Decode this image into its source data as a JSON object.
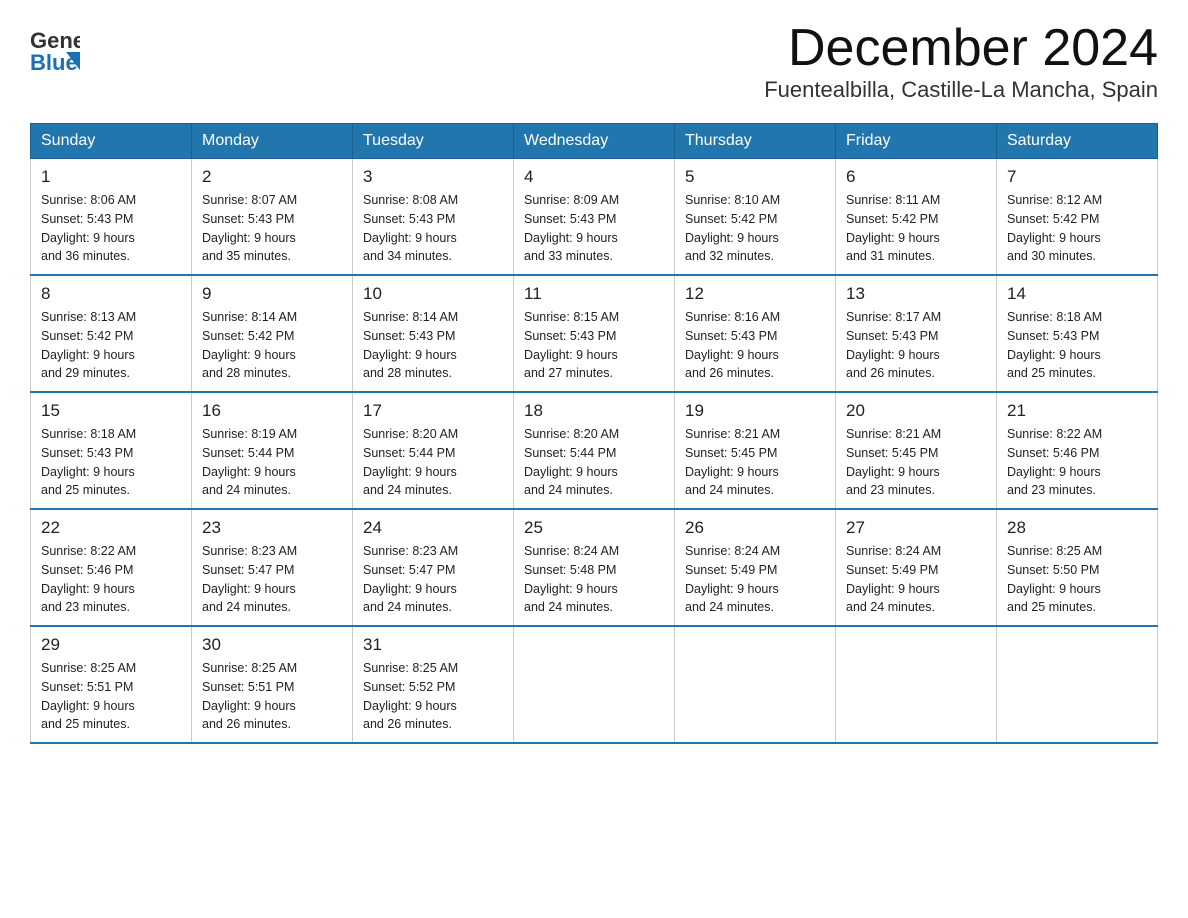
{
  "header": {
    "logo_general": "General",
    "logo_blue": "Blue",
    "title": "December 2024",
    "subtitle": "Fuentealbilla, Castille-La Mancha, Spain"
  },
  "calendar": {
    "days_of_week": [
      "Sunday",
      "Monday",
      "Tuesday",
      "Wednesday",
      "Thursday",
      "Friday",
      "Saturday"
    ],
    "weeks": [
      [
        {
          "day": "1",
          "sunrise": "8:06 AM",
          "sunset": "5:43 PM",
          "daylight": "9 hours and 36 minutes."
        },
        {
          "day": "2",
          "sunrise": "8:07 AM",
          "sunset": "5:43 PM",
          "daylight": "9 hours and 35 minutes."
        },
        {
          "day": "3",
          "sunrise": "8:08 AM",
          "sunset": "5:43 PM",
          "daylight": "9 hours and 34 minutes."
        },
        {
          "day": "4",
          "sunrise": "8:09 AM",
          "sunset": "5:43 PM",
          "daylight": "9 hours and 33 minutes."
        },
        {
          "day": "5",
          "sunrise": "8:10 AM",
          "sunset": "5:42 PM",
          "daylight": "9 hours and 32 minutes."
        },
        {
          "day": "6",
          "sunrise": "8:11 AM",
          "sunset": "5:42 PM",
          "daylight": "9 hours and 31 minutes."
        },
        {
          "day": "7",
          "sunrise": "8:12 AM",
          "sunset": "5:42 PM",
          "daylight": "9 hours and 30 minutes."
        }
      ],
      [
        {
          "day": "8",
          "sunrise": "8:13 AM",
          "sunset": "5:42 PM",
          "daylight": "9 hours and 29 minutes."
        },
        {
          "day": "9",
          "sunrise": "8:14 AM",
          "sunset": "5:42 PM",
          "daylight": "9 hours and 28 minutes."
        },
        {
          "day": "10",
          "sunrise": "8:14 AM",
          "sunset": "5:43 PM",
          "daylight": "9 hours and 28 minutes."
        },
        {
          "day": "11",
          "sunrise": "8:15 AM",
          "sunset": "5:43 PM",
          "daylight": "9 hours and 27 minutes."
        },
        {
          "day": "12",
          "sunrise": "8:16 AM",
          "sunset": "5:43 PM",
          "daylight": "9 hours and 26 minutes."
        },
        {
          "day": "13",
          "sunrise": "8:17 AM",
          "sunset": "5:43 PM",
          "daylight": "9 hours and 26 minutes."
        },
        {
          "day": "14",
          "sunrise": "8:18 AM",
          "sunset": "5:43 PM",
          "daylight": "9 hours and 25 minutes."
        }
      ],
      [
        {
          "day": "15",
          "sunrise": "8:18 AM",
          "sunset": "5:43 PM",
          "daylight": "9 hours and 25 minutes."
        },
        {
          "day": "16",
          "sunrise": "8:19 AM",
          "sunset": "5:44 PM",
          "daylight": "9 hours and 24 minutes."
        },
        {
          "day": "17",
          "sunrise": "8:20 AM",
          "sunset": "5:44 PM",
          "daylight": "9 hours and 24 minutes."
        },
        {
          "day": "18",
          "sunrise": "8:20 AM",
          "sunset": "5:44 PM",
          "daylight": "9 hours and 24 minutes."
        },
        {
          "day": "19",
          "sunrise": "8:21 AM",
          "sunset": "5:45 PM",
          "daylight": "9 hours and 24 minutes."
        },
        {
          "day": "20",
          "sunrise": "8:21 AM",
          "sunset": "5:45 PM",
          "daylight": "9 hours and 23 minutes."
        },
        {
          "day": "21",
          "sunrise": "8:22 AM",
          "sunset": "5:46 PM",
          "daylight": "9 hours and 23 minutes."
        }
      ],
      [
        {
          "day": "22",
          "sunrise": "8:22 AM",
          "sunset": "5:46 PM",
          "daylight": "9 hours and 23 minutes."
        },
        {
          "day": "23",
          "sunrise": "8:23 AM",
          "sunset": "5:47 PM",
          "daylight": "9 hours and 24 minutes."
        },
        {
          "day": "24",
          "sunrise": "8:23 AM",
          "sunset": "5:47 PM",
          "daylight": "9 hours and 24 minutes."
        },
        {
          "day": "25",
          "sunrise": "8:24 AM",
          "sunset": "5:48 PM",
          "daylight": "9 hours and 24 minutes."
        },
        {
          "day": "26",
          "sunrise": "8:24 AM",
          "sunset": "5:49 PM",
          "daylight": "9 hours and 24 minutes."
        },
        {
          "day": "27",
          "sunrise": "8:24 AM",
          "sunset": "5:49 PM",
          "daylight": "9 hours and 24 minutes."
        },
        {
          "day": "28",
          "sunrise": "8:25 AM",
          "sunset": "5:50 PM",
          "daylight": "9 hours and 25 minutes."
        }
      ],
      [
        {
          "day": "29",
          "sunrise": "8:25 AM",
          "sunset": "5:51 PM",
          "daylight": "9 hours and 25 minutes."
        },
        {
          "day": "30",
          "sunrise": "8:25 AM",
          "sunset": "5:51 PM",
          "daylight": "9 hours and 26 minutes."
        },
        {
          "day": "31",
          "sunrise": "8:25 AM",
          "sunset": "5:52 PM",
          "daylight": "9 hours and 26 minutes."
        },
        null,
        null,
        null,
        null
      ]
    ],
    "labels": {
      "sunrise": "Sunrise:",
      "sunset": "Sunset:",
      "daylight": "Daylight:"
    }
  }
}
